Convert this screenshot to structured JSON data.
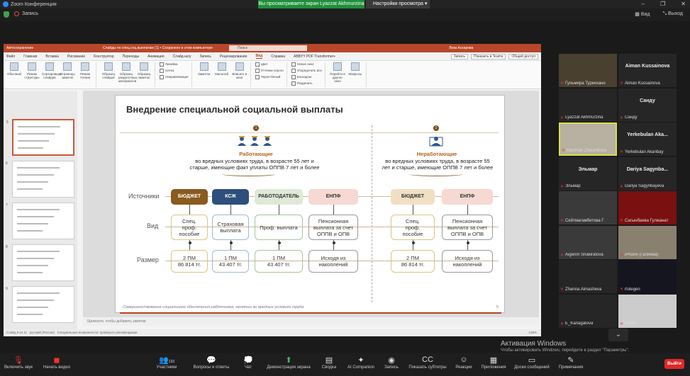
{
  "window": {
    "title": "Zoom Конференция",
    "share_banner": "Вы просматриваете экран Lyazzat Akhmurzina",
    "view_options": "Настройки просмотра",
    "record": "Запись",
    "view": "Вид",
    "exit_fullscreen": "Выход"
  },
  "ppt": {
    "autosave": "Автосохранение",
    "doc_title": "Слайды по спец.соц.выплатам (1) • Сохранено в этом компьютере",
    "search": "Поиск",
    "user": "Лиза Аскарова",
    "tabs": [
      "Файл",
      "Главная",
      "Вставка",
      "Рисование",
      "Конструктор",
      "Переходы",
      "Анимация",
      "Слайд-шоу",
      "Запись",
      "Рецензирование",
      "Вид",
      "Справка",
      "ABBYY PDF Transformer+"
    ],
    "active_tab": "Вид",
    "right_buttons": [
      "Запись",
      "Показать в Teams",
      "Общий доступ"
    ],
    "ribbon": {
      "views": [
        "Обычный",
        "Режим структуры",
        "Сортировщик слайдов",
        "Страницы заметок",
        "Режим чтения"
      ],
      "masters": [
        "Образец слайдов",
        "Образец раздаточных материалов",
        "Образец заметок"
      ],
      "show": [
        "Линейка",
        "Сетка",
        "Направляющие"
      ],
      "zoom": [
        "Заметки",
        "Масштаб",
        "Вписать в окно"
      ],
      "color": [
        "Цвет",
        "Оттенки серого",
        "Черно-белый"
      ],
      "window": [
        "Новое окно",
        "Упорядочить все",
        "Каскадом",
        "Разделить"
      ],
      "macros": [
        "Перейти в другое окно",
        "Макросы"
      ],
      "group_labels": [
        "Режимы просмотра презентации",
        "Режимы образцов",
        "Отображение",
        "Масштаб",
        "Цвет или оттенки серого",
        "Окно",
        "Макросы"
      ]
    },
    "thumbnails": [
      "5",
      "6",
      "7",
      "8",
      "9"
    ],
    "notes_placeholder": "Щелкните, чтобы добавить заметки",
    "status": "Слайд 5 из 11",
    "status_lang": "русский (Россия)",
    "status_access": "Специальные возможности: проверьте рекомендации",
    "status_zoom": "138%"
  },
  "slide": {
    "title": "Внедрение специальной социальной выплаты",
    "left": {
      "number": "1",
      "heading": "Работающие",
      "desc1": "во вредных условиях труда, в возрасте 55 лет и",
      "desc2": "старше, имеющие факт уплаты  ОППВ 7 лет и более"
    },
    "right": {
      "number": "2",
      "heading": "Неработающие",
      "desc1": "во вредных условиях труда, в возрасте 55",
      "desc2": "лет и старше, имеющие ОППВ 7 лет и более"
    },
    "rows": [
      "Источники",
      "Вид",
      "Размер"
    ],
    "sources": [
      "БЮДЖЕТ",
      "КСЖ",
      "РАБОТОДАТЕЛЬ",
      "ЕНПФ",
      "БЮДЖЕТ",
      "ЕНПФ"
    ],
    "types": [
      [
        "Спец.",
        "проф.",
        "пособие"
      ],
      [
        "Страховая",
        "выплата"
      ],
      [
        "Проф. выплата"
      ],
      [
        "Пенсионная",
        "выплата за счет",
        "ОППВ и ОПВ"
      ],
      [
        "Спец.",
        "проф.",
        "пособие"
      ],
      [
        "Пенсионная",
        "выплата за счет",
        "ОППВ и ОПВ"
      ]
    ],
    "sizes": [
      [
        "2 ПМ",
        "86 814 тг."
      ],
      [
        "1 ПМ",
        "43 407 тг."
      ],
      [
        "1 ПМ",
        "43 407 тг."
      ],
      [
        "Исходя из",
        "накоплений"
      ],
      [
        "2 ПМ",
        "86 814 тг."
      ],
      [
        "Исходя из",
        "накоплений"
      ]
    ],
    "footer": "Совершенствование социального обеспечения работников, занятых во вредных условиях труда",
    "page": "5"
  },
  "participants": [
    {
      "name": "Гульмира Турекхано",
      "big": "",
      "video": true
    },
    {
      "name": "Aiman Kussainova",
      "big": "Aiman Kussainova",
      "video": false
    },
    {
      "name": "Lyazzat Akhmurzina",
      "big": "",
      "video": false
    },
    {
      "name": "Санду",
      "big": "Санду",
      "video": false
    },
    {
      "name": "Marzhan Zhaumitova",
      "big": "",
      "video": true
    },
    {
      "name": "Yerkebulan Akanbay",
      "big": "Yerkebulan Aka...",
      "video": false
    },
    {
      "name": "Эльмар",
      "big": "Эльмар",
      "video": false
    },
    {
      "name": "Dariya Sagynbayeva",
      "big": "Dariya Sagynba...",
      "video": false
    },
    {
      "name": "Сейтмагамбетова Г",
      "big": "",
      "video": false
    },
    {
      "name": "Сагынбаева Гулжанат",
      "big": "",
      "video": false
    },
    {
      "name": "Aigerim Shakiratova",
      "big": "",
      "video": false
    },
    {
      "name": "iPhone (Галиева)",
      "big": "",
      "video": true
    },
    {
      "name": "Zhanna Aimasheva",
      "big": "",
      "video": false
    },
    {
      "name": "rtolegen",
      "big": "",
      "video": false
    },
    {
      "name": "E_Kanagatova",
      "big": "",
      "video": false
    },
    {
      "name": "Разия",
      "big": "",
      "video": false
    }
  ],
  "toolbar": {
    "mute": "Включить звук",
    "video": "Начать видео",
    "participants": "Участники",
    "participants_count": "133",
    "qa": "Вопросы и ответы",
    "chat": "Чат",
    "share": "Демонстрация экрана",
    "summary": "Сводка",
    "ai": "AI Companion",
    "record": "Запись",
    "captions": "Показать субтитры",
    "reactions": "Реакции",
    "apps": "Приложения",
    "whiteboards": "Доски сообщений",
    "notes": "Примечания",
    "leave": "Выйти"
  },
  "activation": {
    "title": "Активация Windows",
    "text": "Чтобы активировать Windows, перейдите в раздел \"Параметры\"."
  }
}
